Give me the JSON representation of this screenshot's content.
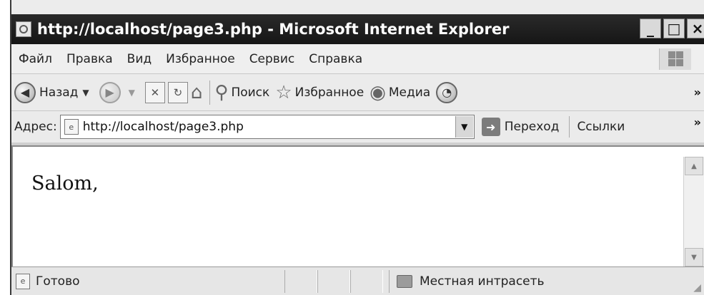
{
  "window": {
    "title": "http://localhost/page3.php - Microsoft Internet Explorer",
    "buttons": {
      "minimize": "_",
      "maximize": "□",
      "close": "×"
    }
  },
  "menu": {
    "items": [
      "Файл",
      "Правка",
      "Вид",
      "Избранное",
      "Сервис",
      "Справка"
    ]
  },
  "toolbar": {
    "back_label": "Назад",
    "search_label": "Поиск",
    "favorites_label": "Избранное",
    "media_label": "Медиа",
    "more": "»"
  },
  "address": {
    "label": "Адрес:",
    "value": "http://localhost/page3.php",
    "go_label": "Переход",
    "links_label": "Ссылки",
    "more": "»"
  },
  "content": {
    "text": "Salom,"
  },
  "status": {
    "text": "Готово",
    "zone": "Местная интрасеть"
  },
  "icons": [
    "ie-page-icon",
    "back-icon",
    "forward-icon",
    "stop-icon",
    "refresh-icon",
    "home-icon",
    "search-icon",
    "favorites-star-icon",
    "media-icon",
    "history-icon",
    "go-arrow-icon",
    "windows-logo-icon",
    "intranet-zone-icon"
  ]
}
